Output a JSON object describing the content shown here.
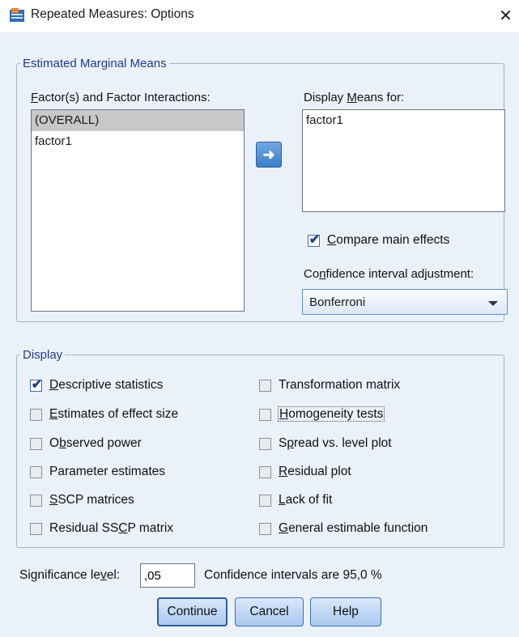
{
  "window": {
    "title": "Repeated Measures: Options",
    "close_glyph": "✕",
    "icon": "spss-dialog-icon"
  },
  "emm": {
    "legend": "Estimated Marginal Means",
    "factors_label_accel": "F",
    "factors_label_rest": "actor(s) and Factor Interactions:",
    "factors_items": [
      "(OVERALL)",
      "factor1"
    ],
    "factors_selected_index": 0,
    "move_button_glyph": "➜",
    "display_label_pre": "Display ",
    "display_label_accel": "M",
    "display_label_post": "eans for:",
    "display_items": [
      "factor1"
    ],
    "compare_checked": true,
    "compare_label_accel": "C",
    "compare_label_rest": "ompare main effects",
    "ci_label_pre": "Co",
    "ci_label_accel": "n",
    "ci_label_post": "fidence interval adjustment:",
    "ci_value": "Bonferroni"
  },
  "display": {
    "legend": "Display",
    "left": [
      {
        "accel": "D",
        "rest": "escriptive statistics",
        "pre": "",
        "checked": true
      },
      {
        "accel": "E",
        "rest": "stimates of effect size",
        "pre": "",
        "checked": false
      },
      {
        "accel": "b",
        "rest": "served power",
        "pre": "O",
        "checked": false
      },
      {
        "accel": "",
        "rest": "Parameter estimates",
        "pre": "",
        "checked": false
      },
      {
        "accel": "S",
        "rest": "SCP matrices",
        "pre": "",
        "checked": false
      },
      {
        "accel": "C",
        "rest": "P matrix",
        "pre": "Residual SS",
        "checked": false
      }
    ],
    "right": [
      {
        "accel": "",
        "rest": "Transformation matrix",
        "pre": "",
        "checked": false
      },
      {
        "accel": "H",
        "rest": "omogeneity tests",
        "pre": "",
        "checked": false
      },
      {
        "accel": "p",
        "rest": "read vs. level plot",
        "pre": "S",
        "checked": false
      },
      {
        "accel": "R",
        "rest": "esidual plot",
        "pre": "",
        "checked": false
      },
      {
        "accel": "L",
        "rest": "ack of fit",
        "pre": "",
        "checked": false
      },
      {
        "accel": "G",
        "rest": "eneral estimable function",
        "pre": "",
        "checked": false
      }
    ]
  },
  "significance": {
    "label_pre": "Significance le",
    "label_accel": "v",
    "label_post": "el:",
    "value": ",05",
    "ci_text": "Confidence intervals are 95,0 %"
  },
  "buttons": {
    "continue": "Continue",
    "cancel": "Cancel",
    "help": "Help"
  }
}
